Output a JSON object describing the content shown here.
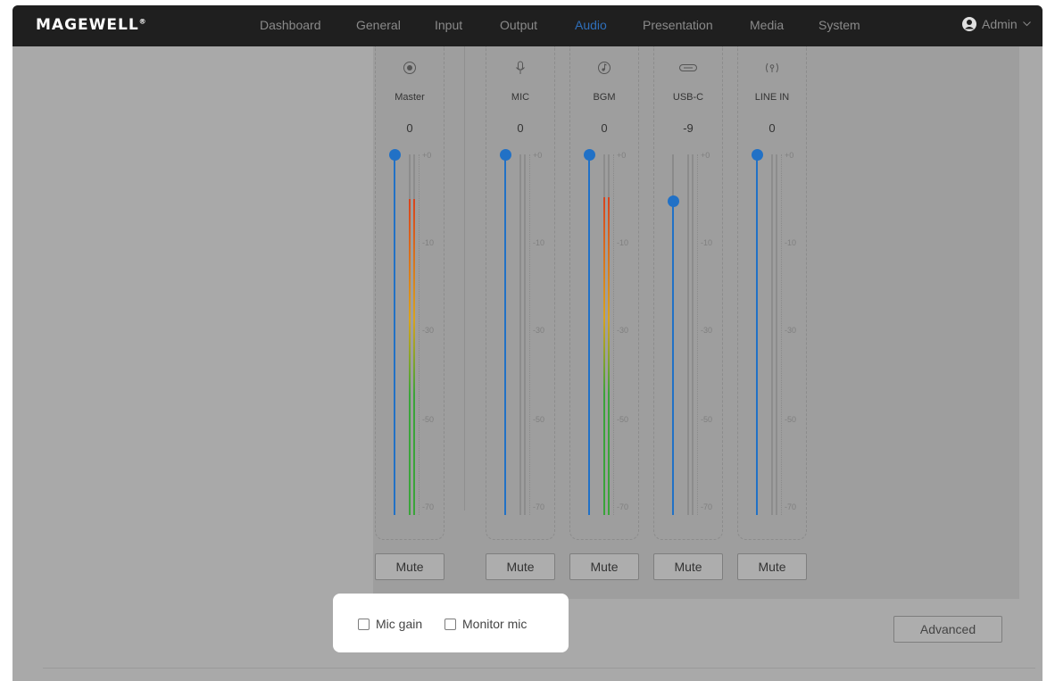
{
  "brand": {
    "logo_text": "MAGEWELL",
    "trademark": "®"
  },
  "nav": {
    "items": [
      "Dashboard",
      "General",
      "Input",
      "Output",
      "Audio",
      "Presentation",
      "Media",
      "System"
    ],
    "active": "Audio",
    "user": "Admin"
  },
  "mixer": {
    "channels": [
      {
        "name": "Master",
        "value": "0",
        "icon": "record-icon",
        "level_db": 0,
        "meter_db": -8.7
      },
      {
        "name": "MIC",
        "value": "0",
        "icon": "microphone-icon",
        "level_db": 0,
        "meter_db": null
      },
      {
        "name": "BGM",
        "value": "0",
        "icon": "music-note-icon",
        "level_db": 0,
        "meter_db": -8.3
      },
      {
        "name": "USB-C",
        "value": "-9",
        "icon": "usb-c-icon",
        "level_db": -9,
        "meter_db": null
      },
      {
        "name": "LINE IN",
        "value": "0",
        "icon": "line-in-icon",
        "level_db": 0,
        "meter_db": null
      }
    ],
    "scale_ticks": [
      "+0",
      "-10",
      "-30",
      "-50",
      "-70"
    ],
    "mute_label": "Mute"
  },
  "options": {
    "mic_gain": {
      "label": "Mic gain",
      "checked": false
    },
    "monitor_mic": {
      "label": "Monitor mic",
      "checked": false
    }
  },
  "advanced_label": "Advanced",
  "colors": {
    "accent": "#2171c6",
    "meter_red": "#d8431d",
    "meter_yellow": "#d9a31c",
    "meter_green": "#3aa43a"
  }
}
